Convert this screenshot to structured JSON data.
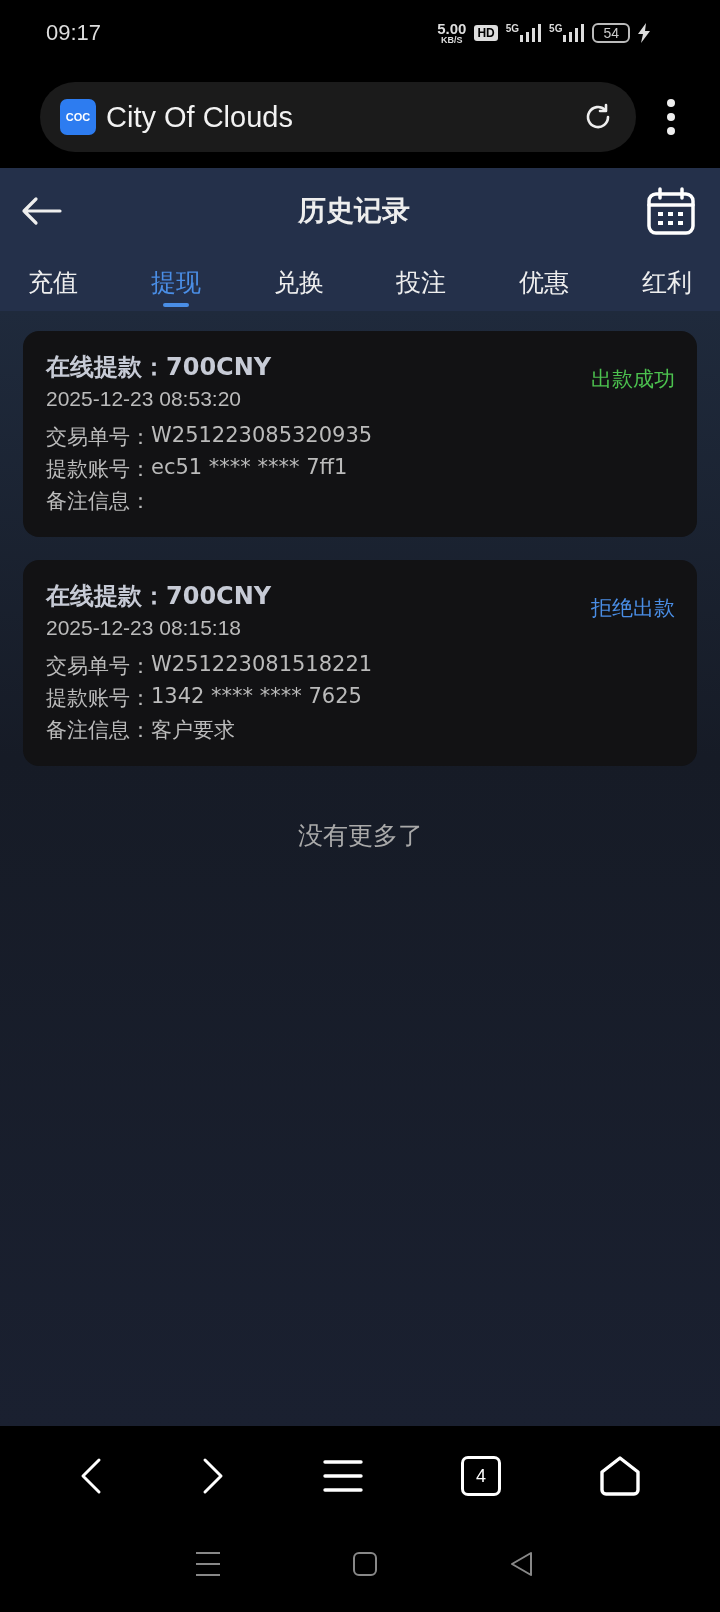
{
  "status_bar": {
    "time": "09:17",
    "speed": "5.00",
    "speed_unit": "KB/S",
    "hd": "HD",
    "signals": [
      "5G",
      "5G"
    ],
    "battery": "54"
  },
  "browser": {
    "title": "City Of Clouds",
    "logo": "COC",
    "tab_count": "4"
  },
  "header": {
    "title": "历史记录"
  },
  "tabs": [
    {
      "label": "充值",
      "selected": false
    },
    {
      "label": "提现",
      "selected": true
    },
    {
      "label": "兑换",
      "selected": false
    },
    {
      "label": "投注",
      "selected": false
    },
    {
      "label": "优惠",
      "selected": false
    },
    {
      "label": "红利",
      "selected": false
    }
  ],
  "records": [
    {
      "title": "在线提款：700CNY",
      "time": "2025-12-23 08:53:20",
      "status": "出款成功",
      "kind": "success",
      "fields": [
        {
          "label": "交易单号：",
          "value": "W251223085320935"
        },
        {
          "label": "提款账号：",
          "value": "ec51 **** **** 7ff1"
        },
        {
          "label": "备注信息："
        }
      ]
    },
    {
      "title": "在线提款：700CNY",
      "time": "2025-12-23 08:15:18",
      "status": "拒绝出款",
      "kind": "rejected",
      "fields": [
        {
          "label": "交易单号：",
          "value": "W251223081518221"
        },
        {
          "label": "提款账号：",
          "value": "1342 **** **** 7625"
        },
        {
          "label": "备注信息：",
          "value": "客户要求"
        }
      ]
    }
  ],
  "end_text": "没有更多了"
}
